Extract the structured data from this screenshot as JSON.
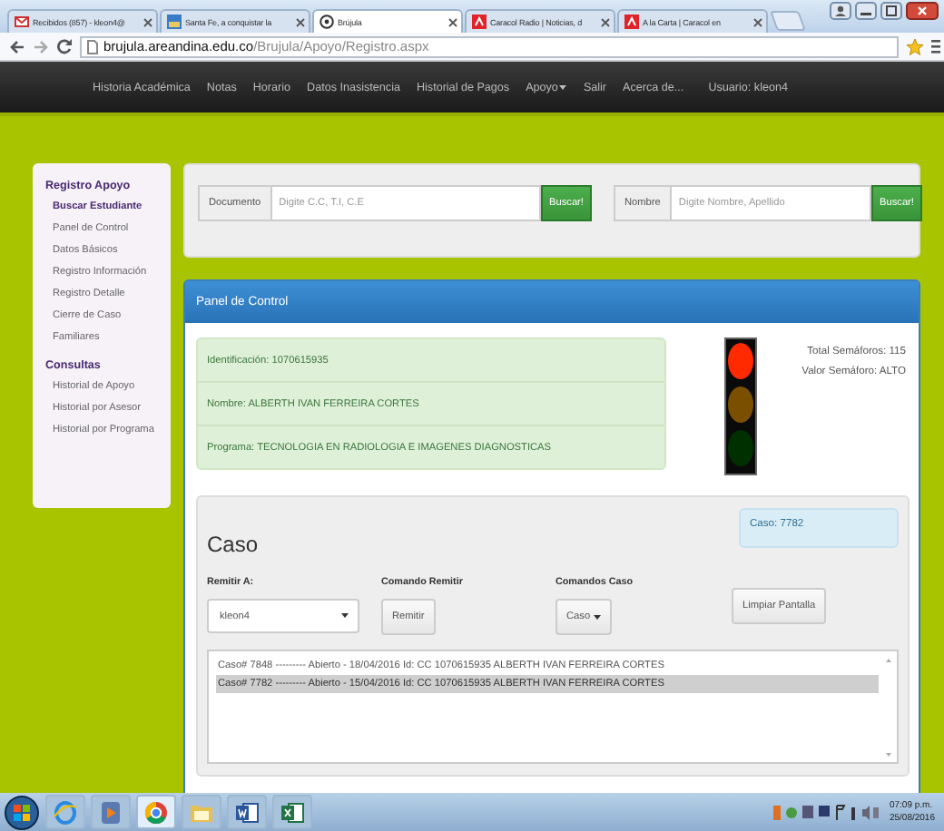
{
  "browser": {
    "tabs": [
      {
        "kind": "mail",
        "title": "Recibidos (857) - kleon4@",
        "selected": false
      },
      {
        "kind": "photo",
        "title": "Santa Fe, a conquistar la",
        "selected": false
      },
      {
        "kind": "compass",
        "title": "Brújula",
        "selected": true
      },
      {
        "kind": "radio",
        "title": "Caracol Radio | Noticias, d",
        "selected": false
      },
      {
        "kind": "radio",
        "title": "A la Carta | Caracol en",
        "selected": false
      }
    ],
    "address": {
      "domain": "brujula.areandina.edu.co",
      "path": "/Brujula/Apoyo/Registro.aspx"
    }
  },
  "navbar": {
    "items": [
      {
        "label": "Historia Académica",
        "dropdown": false
      },
      {
        "label": "Notas",
        "dropdown": false
      },
      {
        "label": "Horario",
        "dropdown": false
      },
      {
        "label": "Datos Inasistencia",
        "dropdown": false
      },
      {
        "label": "Historial de Pagos",
        "dropdown": false
      },
      {
        "label": "Apoyo",
        "dropdown": true
      },
      {
        "label": "Salir",
        "dropdown": false
      },
      {
        "label": "Acerca de...",
        "dropdown": false
      }
    ],
    "user": "Usuario: kleon4"
  },
  "sidebar": {
    "sections": [
      {
        "heading": "Registro Apoyo",
        "items": [
          {
            "label": "Buscar Estudiante",
            "selected": true
          },
          {
            "label": "Panel de Control",
            "selected": false
          },
          {
            "label": "Datos Básicos",
            "selected": false
          },
          {
            "label": "Registro Información",
            "selected": false
          },
          {
            "label": "Registro Detalle",
            "selected": false
          },
          {
            "label": "Cierre de Caso",
            "selected": false
          },
          {
            "label": "Familiares",
            "selected": false
          }
        ]
      },
      {
        "heading": "Consultas",
        "items": [
          {
            "label": "Historial de Apoyo",
            "selected": false
          },
          {
            "label": "Historial por Asesor",
            "selected": false
          },
          {
            "label": "Historial por Programa",
            "selected": false
          }
        ]
      }
    ]
  },
  "search": {
    "fields": [
      {
        "label": "Documento",
        "placeholder": "Digite C.C, T.I, C.E",
        "button": "Buscar!"
      },
      {
        "label": "Nombre",
        "placeholder": "Digite Nombre, Apellido",
        "button": "Buscar!"
      }
    ]
  },
  "panel": {
    "title": "Panel de Control",
    "info_rows": [
      "Identificación: 1070615935",
      "Nombre: ALBERTH IVAN FERREIRA CORTES",
      "Programa: TECNOLOGIA EN RADIOLOGIA E IMAGENES DIAGNOSTICAS"
    ],
    "lamps": [
      {
        "kind": "red",
        "lit": true
      },
      {
        "kind": "amber",
        "lit": false
      },
      {
        "kind": "green",
        "lit": false
      }
    ],
    "totals": [
      "Total Semáforos: 115",
      "Valor Semáforo: ALTO"
    ]
  },
  "caso": {
    "title": "Caso",
    "badge": "Caso: 7782",
    "controls": [
      {
        "kind": "select",
        "label": "Remitir A:",
        "value": "kleon4"
      },
      {
        "kind": "button",
        "label": "Comando Remitir",
        "text": "Remitir"
      },
      {
        "kind": "dropdown",
        "label": "Comandos Caso",
        "text": "Caso"
      },
      {
        "kind": "button",
        "text": "Limpiar Pantalla"
      }
    ],
    "cases": [
      {
        "text": "Caso# 7848 --------- Abierto - 18/04/2016 Id: CC 1070615935 ALBERTH IVAN FERREIRA CORTES",
        "selected": false
      },
      {
        "text": "Caso# 7782 --------- Abierto - 15/04/2016 Id: CC 1070615935 ALBERTH IVAN FERREIRA CORTES",
        "selected": true
      }
    ]
  },
  "taskbar": {
    "apps": [
      {
        "kind": "ring",
        "active": false
      },
      {
        "kind": "media",
        "active": false
      },
      {
        "kind": "wheel",
        "active": true
      },
      {
        "kind": "folder",
        "active": false
      },
      {
        "kind": "doc",
        "active": false
      },
      {
        "kind": "sheet",
        "active": false
      }
    ],
    "time": "07:09 p.m.",
    "date": "25/08/2016"
  }
}
